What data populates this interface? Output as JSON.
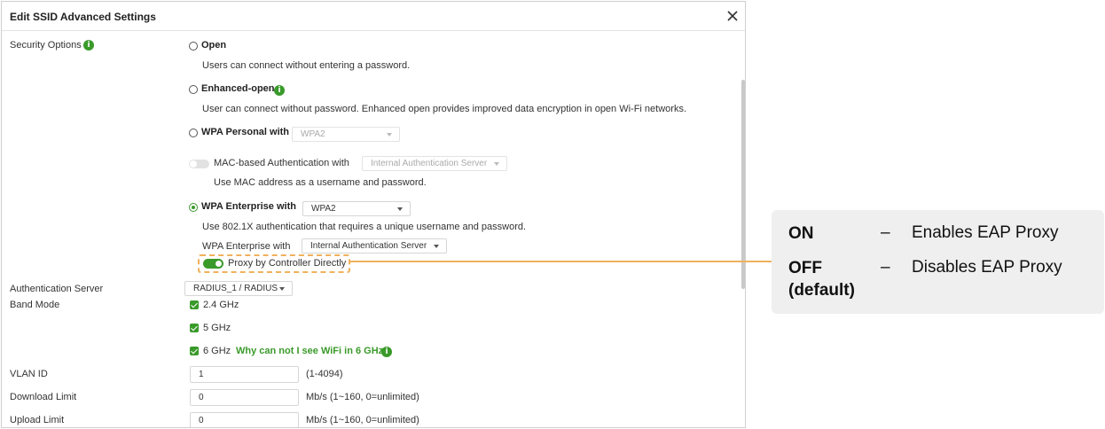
{
  "dialog": {
    "title": "Edit SSID Advanced Settings",
    "close_icon": "close-icon"
  },
  "security": {
    "label": "Security Options",
    "open": {
      "label": "Open",
      "desc": "Users can connect without entering a password."
    },
    "enhanced_open": {
      "label": "Enhanced-open",
      "desc": "User can connect without password. Enhanced open provides improved data encryption in open Wi-Fi networks."
    },
    "wpa_personal": {
      "label": "WPA Personal with",
      "select_value": "WPA2"
    },
    "mac_auth": {
      "label": "MAC-based Authentication with",
      "select_value": "Internal Authentication Server",
      "desc": "Use MAC address as a username and password."
    },
    "wpa_enterprise": {
      "label": "WPA Enterprise with",
      "select_value": "WPA2",
      "desc": "Use 802.1X authentication that requires a unique username and password.",
      "server_label": "WPA Enterprise with",
      "server_value": "Internal Authentication Server",
      "proxy_label": "Proxy by Controller Directly",
      "selected": true
    }
  },
  "auth_server": {
    "label": "Authentication Server",
    "value": "RADIUS_1 / RADIUS"
  },
  "band_mode": {
    "label": "Band Mode",
    "bands": [
      "2.4 GHz",
      "5 GHz",
      "6 GHz"
    ],
    "link": "Why can not I see WiFi in 6 GHz?"
  },
  "vlan": {
    "label": "VLAN ID",
    "value": "1",
    "hint": "(1-4094)"
  },
  "download": {
    "label": "Download Limit",
    "value": "0",
    "hint": "Mb/s (1~160, 0=unlimited)"
  },
  "upload": {
    "label": "Upload Limit",
    "value": "0",
    "hint": "Mb/s (1~160, 0=unlimited)"
  },
  "callout": {
    "on_key": "ON",
    "on_dash": "–",
    "on_val": "Enables EAP Proxy",
    "off_key_1": "OFF",
    "off_key_2": "(default)",
    "off_dash": "–",
    "off_val": "Disables EAP Proxy"
  },
  "colors": {
    "accent": "#3a9a2a",
    "highlight": "#f0b15c",
    "callout_bg": "#efefef"
  }
}
